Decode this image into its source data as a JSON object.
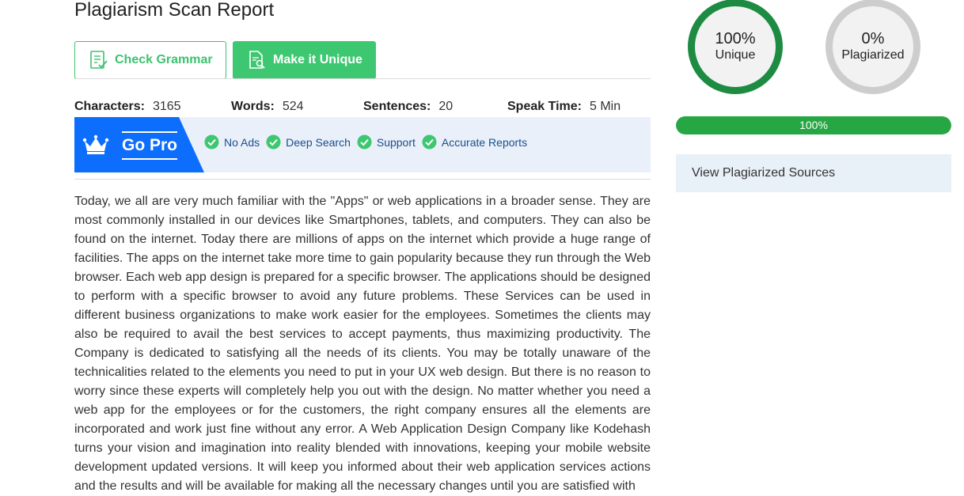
{
  "page_title": "Plagiarism Scan Report",
  "buttons": {
    "check_grammar": "Check Grammar",
    "make_unique": "Make it Unique"
  },
  "stats": {
    "characters_label": "Characters:",
    "characters_value": "3165",
    "words_label": "Words:",
    "words_value": "524",
    "sentences_label": "Sentences:",
    "sentences_value": "20",
    "speak_time_label": "Speak Time:",
    "speak_time_value": "5 Min"
  },
  "go_pro": {
    "label": "Go Pro",
    "features": [
      "No Ads",
      "Deep Search",
      "Support",
      "Accurate Reports"
    ]
  },
  "body_text": "Today, we all are very much familiar with the \"Apps\" or web applications in a broader sense. They are most commonly installed in our devices like Smartphones, tablets, and computers. They can also be found on the internet. Today there are millions of apps on the internet which provide a huge range of facilities. The apps on the internet take more time to gain popularity because they run through the Web browser. Each web app design is prepared for a specific browser. The applications should be designed to perform with a specific browser to avoid any future problems. These Services can be used in different business organizations to make work easier for the employees. Sometimes the clients may also be required to avail the best services to accept payments, thus maximizing productivity. The Company is dedicated to satisfying all the needs of its clients. You may be totally unaware of the technicalities related to the elements you need to put in your UX web design. But there is no reason to worry since these experts will completely help you out with the design. No matter whether you need a web app for the employees or for the customers, the right company ensures all the elements are incorporated and work just fine without any error. A Web Application Design Company like Kodehash turns your vision and imagination into reality blended with innovations, keeping your mobile website development updated versions. It will keep you informed about their web application services actions and the results and will be available for making all the necessary changes until you are satisfied with",
  "results": {
    "unique_pct": "100%",
    "unique_label": "Unique",
    "plagiarized_pct": "0%",
    "plagiarized_label": "Plagiarized",
    "progress_label": "100%",
    "progress_value": 1.0,
    "sources_label": "View Plagiarized Sources"
  },
  "colors": {
    "green": "#3ec771",
    "dark_green": "#1e8b43",
    "progress_green": "#27a744",
    "blue": "#0d6efd",
    "grey_ring": "#cdcdcd"
  },
  "icons": [
    "grammar-check-icon",
    "document-search-icon",
    "crown-icon",
    "check-circle-icon"
  ]
}
